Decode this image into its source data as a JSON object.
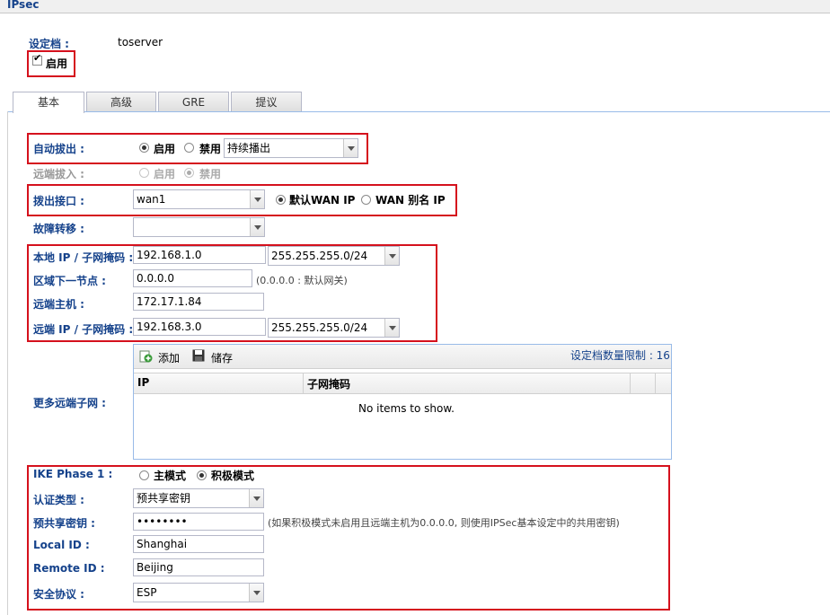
{
  "window": {
    "title": "IPsec"
  },
  "profile": {
    "label": "设定档 :",
    "value": "toserver",
    "enable_label": "启用"
  },
  "tabs": [
    {
      "label": "基本"
    },
    {
      "label": "高级"
    },
    {
      "label": "GRE"
    },
    {
      "label": "提议"
    }
  ],
  "auto_dialout": {
    "label": "自动拔出 :",
    "enable": "启用",
    "disable": "禁用",
    "selected": "enable",
    "mode": "持续播出"
  },
  "remote_dialin": {
    "label": "远端拔入 :",
    "enable": "启用",
    "disable": "禁用",
    "selected": "disable"
  },
  "dialout_iface": {
    "label": "拨出接口 :",
    "value": "wan1",
    "default_wan": "默认WAN IP",
    "wan_alias": "WAN 别名 IP",
    "selected": "default_wan"
  },
  "failover": {
    "label": "故障转移 :",
    "value": ""
  },
  "local_ip": {
    "label": "本地 IP / 子网掩码 :",
    "ip": "192.168.1.0",
    "mask": "255.255.255.0/24"
  },
  "next_hop": {
    "label": "区域下一节点 :",
    "value": "0.0.0.0",
    "hint": "(0.0.0.0 : 默认网关)"
  },
  "remote_host": {
    "label": "远端主机 :",
    "value": "172.17.1.84"
  },
  "remote_ip": {
    "label": "远端 IP / 子网掩码 :",
    "ip": "192.168.3.0",
    "mask": "255.255.255.0/24"
  },
  "more_subnets": {
    "label": "更多远端子网 :",
    "add": "添加",
    "save": "储存",
    "limit": "设定档数量限制 : 16",
    "columns": [
      "IP",
      "子网掩码"
    ],
    "empty": "No items to show."
  },
  "ike": {
    "label": "IKE Phase 1 :",
    "main_mode": "主模式",
    "aggressive": "积极模式",
    "selected": "aggressive",
    "auth_label": "认证类型 :",
    "auth_value": "预共享密钥",
    "psk_label": "预共享密钥 :",
    "psk_value": "••••••••",
    "psk_hint": "(如果积极模式未启用且远端主机为0.0.0.0, 则使用IPSec基本设定中的共用密钥)",
    "local_id_label": "Local ID :",
    "local_id": "Shanghai",
    "remote_id_label": "Remote ID :",
    "remote_id": "Beijing",
    "proto_label": "安全协议 :",
    "proto_value": "ESP"
  }
}
